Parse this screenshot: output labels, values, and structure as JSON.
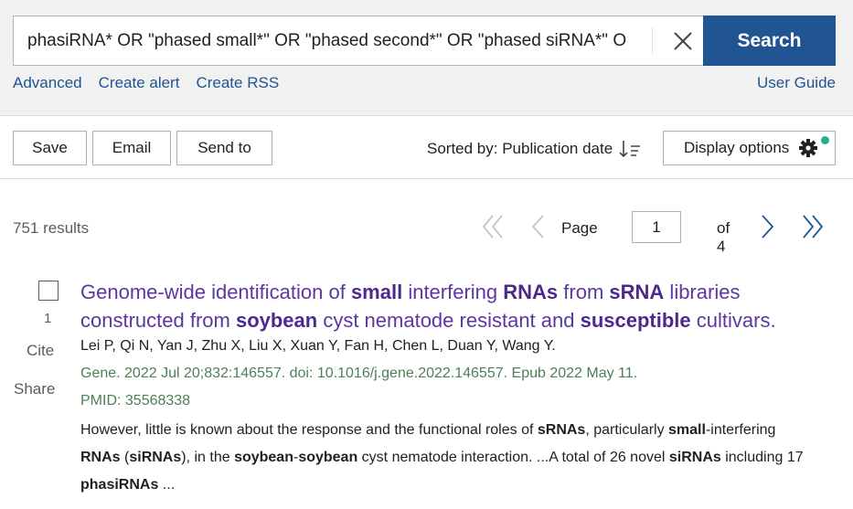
{
  "search": {
    "query": "phasiRNA* OR \"phased small*\" OR \"phased second*\" OR \"phased siRNA*\" O",
    "button": "Search",
    "links": [
      "Advanced",
      "Create alert",
      "Create RSS"
    ],
    "user_guide": "User Guide"
  },
  "toolbar": {
    "save": "Save",
    "email": "Email",
    "send_to": "Send to",
    "sorted_by": "Sorted by: Publication date",
    "display_options": "Display options"
  },
  "results": {
    "count": "751 results",
    "page_label": "Page",
    "current_page": "1",
    "of_pages": "of 4"
  },
  "result_1": {
    "number": "1",
    "cite": "Cite",
    "share": "Share",
    "title_parts": [
      {
        "t": "Genome-wide identification of ",
        "b": false
      },
      {
        "t": "small",
        "b": true
      },
      {
        "t": " interfering ",
        "b": false
      },
      {
        "t": "RNAs",
        "b": true
      },
      {
        "t": " from ",
        "b": false
      },
      {
        "t": "sRNA",
        "b": true
      },
      {
        "t": " libraries constructed from ",
        "b": false
      },
      {
        "t": "soybean",
        "b": true
      },
      {
        "t": " cyst nematode resistant and ",
        "b": false
      },
      {
        "t": "susceptible",
        "b": true
      },
      {
        "t": " cultivars.",
        "b": false
      }
    ],
    "authors": "Lei P, Qi N, Yan J, Zhu X, Liu X, Xuan Y, Fan H, Chen L, Duan Y, Wang Y.",
    "citation": "Gene. 2022 Jul 20;832:146557. doi: 10.1016/j.gene.2022.146557. Epub 2022 May 11.",
    "pmid": "PMID: 35568338",
    "snippet_parts": [
      {
        "t": "However, little is known about the response and the functional roles of ",
        "b": false
      },
      {
        "t": "sRNAs",
        "b": true
      },
      {
        "t": ", particularly ",
        "b": false
      },
      {
        "t": "small",
        "b": true
      },
      {
        "t": "-interfering ",
        "b": false
      },
      {
        "t": "RNAs",
        "b": true
      },
      {
        "t": " (",
        "b": false
      },
      {
        "t": "siRNAs",
        "b": true
      },
      {
        "t": "), in the ",
        "b": false
      },
      {
        "t": "soybean",
        "b": true
      },
      {
        "t": "-",
        "b": false
      },
      {
        "t": "soybean",
        "b": true
      },
      {
        "t": " cyst nematode interaction. ...A total of 26 novel ",
        "b": false
      },
      {
        "t": "siRNAs",
        "b": true
      },
      {
        "t": " including 17 ",
        "b": false
      },
      {
        "t": "phasiRNAs",
        "b": true
      },
      {
        "t": " ...",
        "b": false
      }
    ]
  },
  "colors": {
    "brand_blue": "#205493",
    "title_purple": "#5b37a3",
    "citation_green": "#4d8055",
    "badge_green": "#20b08a"
  },
  "icons": [
    "close-icon",
    "sort-icon",
    "gear-icon",
    "first-page-icon",
    "prev-page-icon",
    "next-page-icon",
    "last-page-icon"
  ]
}
